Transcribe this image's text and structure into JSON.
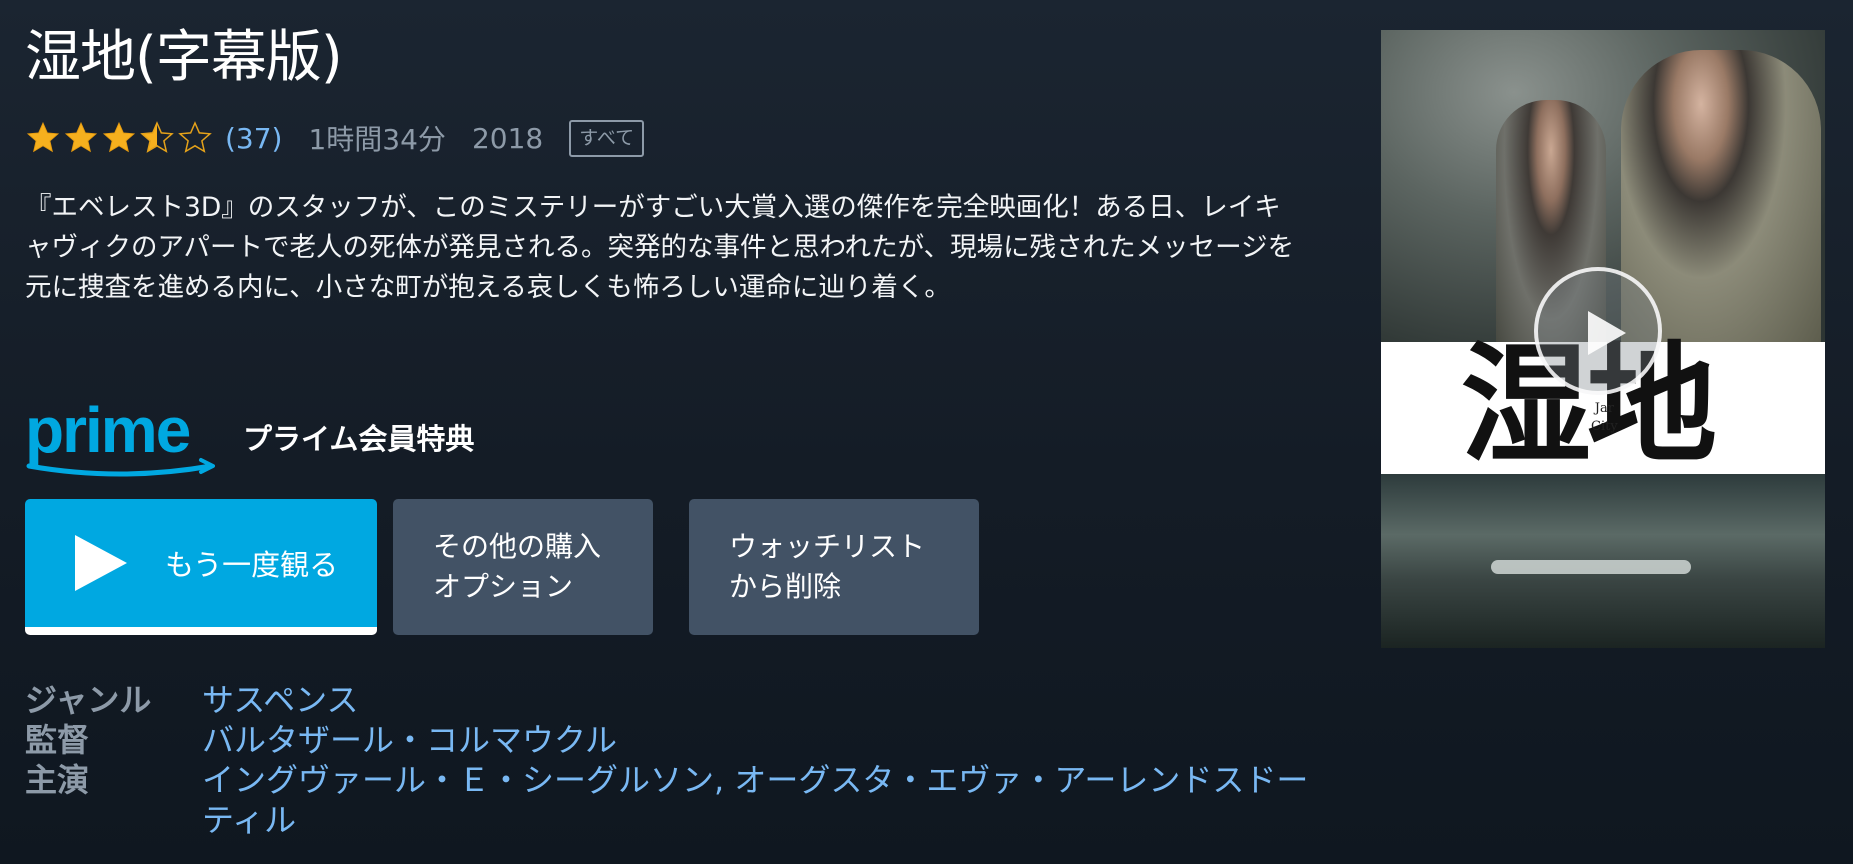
{
  "title": "湿地(字幕版)",
  "rating": {
    "stars": 3.5,
    "max_stars": 5,
    "count_label": "(37)"
  },
  "runtime": "1時間34分",
  "year": "2018",
  "maturity_label": "すべて",
  "synopsis": "『エベレスト3D』のスタッフが、このミステリーがすごい大賞入選の傑作を完全映画化！ある日、レイキャヴィクのアパートで老人の死体が発見される。突発的な事件と思われたが、現場に残されたメッセージを元に捜査を進める内に、小さな町が抱える哀しくも怖ろしい運命に辿り着く。",
  "prime": {
    "logo_text": "prime",
    "benefit_label": "プライム会員特典"
  },
  "buttons": {
    "play_label": "もう一度観る",
    "play_progress": 1.0,
    "other_purchase_line1": "その他の購入",
    "other_purchase_line2": "オプション",
    "watchlist_line1": "ウォッチリスト",
    "watchlist_line2": "から削除"
  },
  "details": {
    "genre_label": "ジャンル",
    "genre_value": "サスペンス",
    "director_label": "監督",
    "director_value": "バルタザール・コルマウクル",
    "cast_label": "主演",
    "cast_value": "イングヴァール・Ｅ・シーグルソン, オーグスタ・エヴァ・アーレンドスドーティル"
  },
  "poster": {
    "title_text": "湿地",
    "subtitle_line1": "Jar",
    "subtitle_line2": "City"
  },
  "colors": {
    "background": "#18212c",
    "accent_blue": "#00a8e1",
    "link_blue": "#79b8f3",
    "muted_text": "#8d9aa8",
    "secondary_button": "#425265",
    "star_gold": "#f6b01e"
  }
}
